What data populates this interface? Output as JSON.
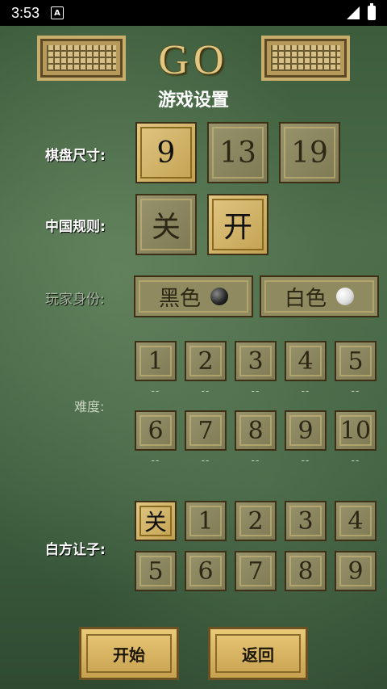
{
  "status": {
    "time": "3:53",
    "notification_badge": "A"
  },
  "header": {
    "logo_text": "GO",
    "title": "游戏设置"
  },
  "board_size": {
    "label": "棋盘尺寸:",
    "options": [
      "9",
      "13",
      "19"
    ],
    "selected": "9"
  },
  "chinese_rules": {
    "label": "中国规则:",
    "options": [
      "关",
      "开"
    ],
    "selected": "开"
  },
  "player_identity": {
    "label": "玩家身份:",
    "options": [
      "黑色",
      "白色"
    ]
  },
  "difficulty": {
    "label": "难度:",
    "row1": [
      "1",
      "2",
      "3",
      "4",
      "5"
    ],
    "row2": [
      "6",
      "7",
      "8",
      "9",
      "10"
    ],
    "marker": "--"
  },
  "handicap": {
    "label": "白方让子:",
    "row1": [
      "关",
      "1",
      "2",
      "3",
      "4"
    ],
    "row2": [
      "5",
      "6",
      "7",
      "8",
      "9"
    ],
    "selected": "关"
  },
  "buttons": {
    "start": "开始",
    "back": "返回"
  },
  "colors": {
    "accent_gold": "#d8b45a",
    "tile_bg": "#8f8a5f",
    "background": "#4c6d4a"
  }
}
